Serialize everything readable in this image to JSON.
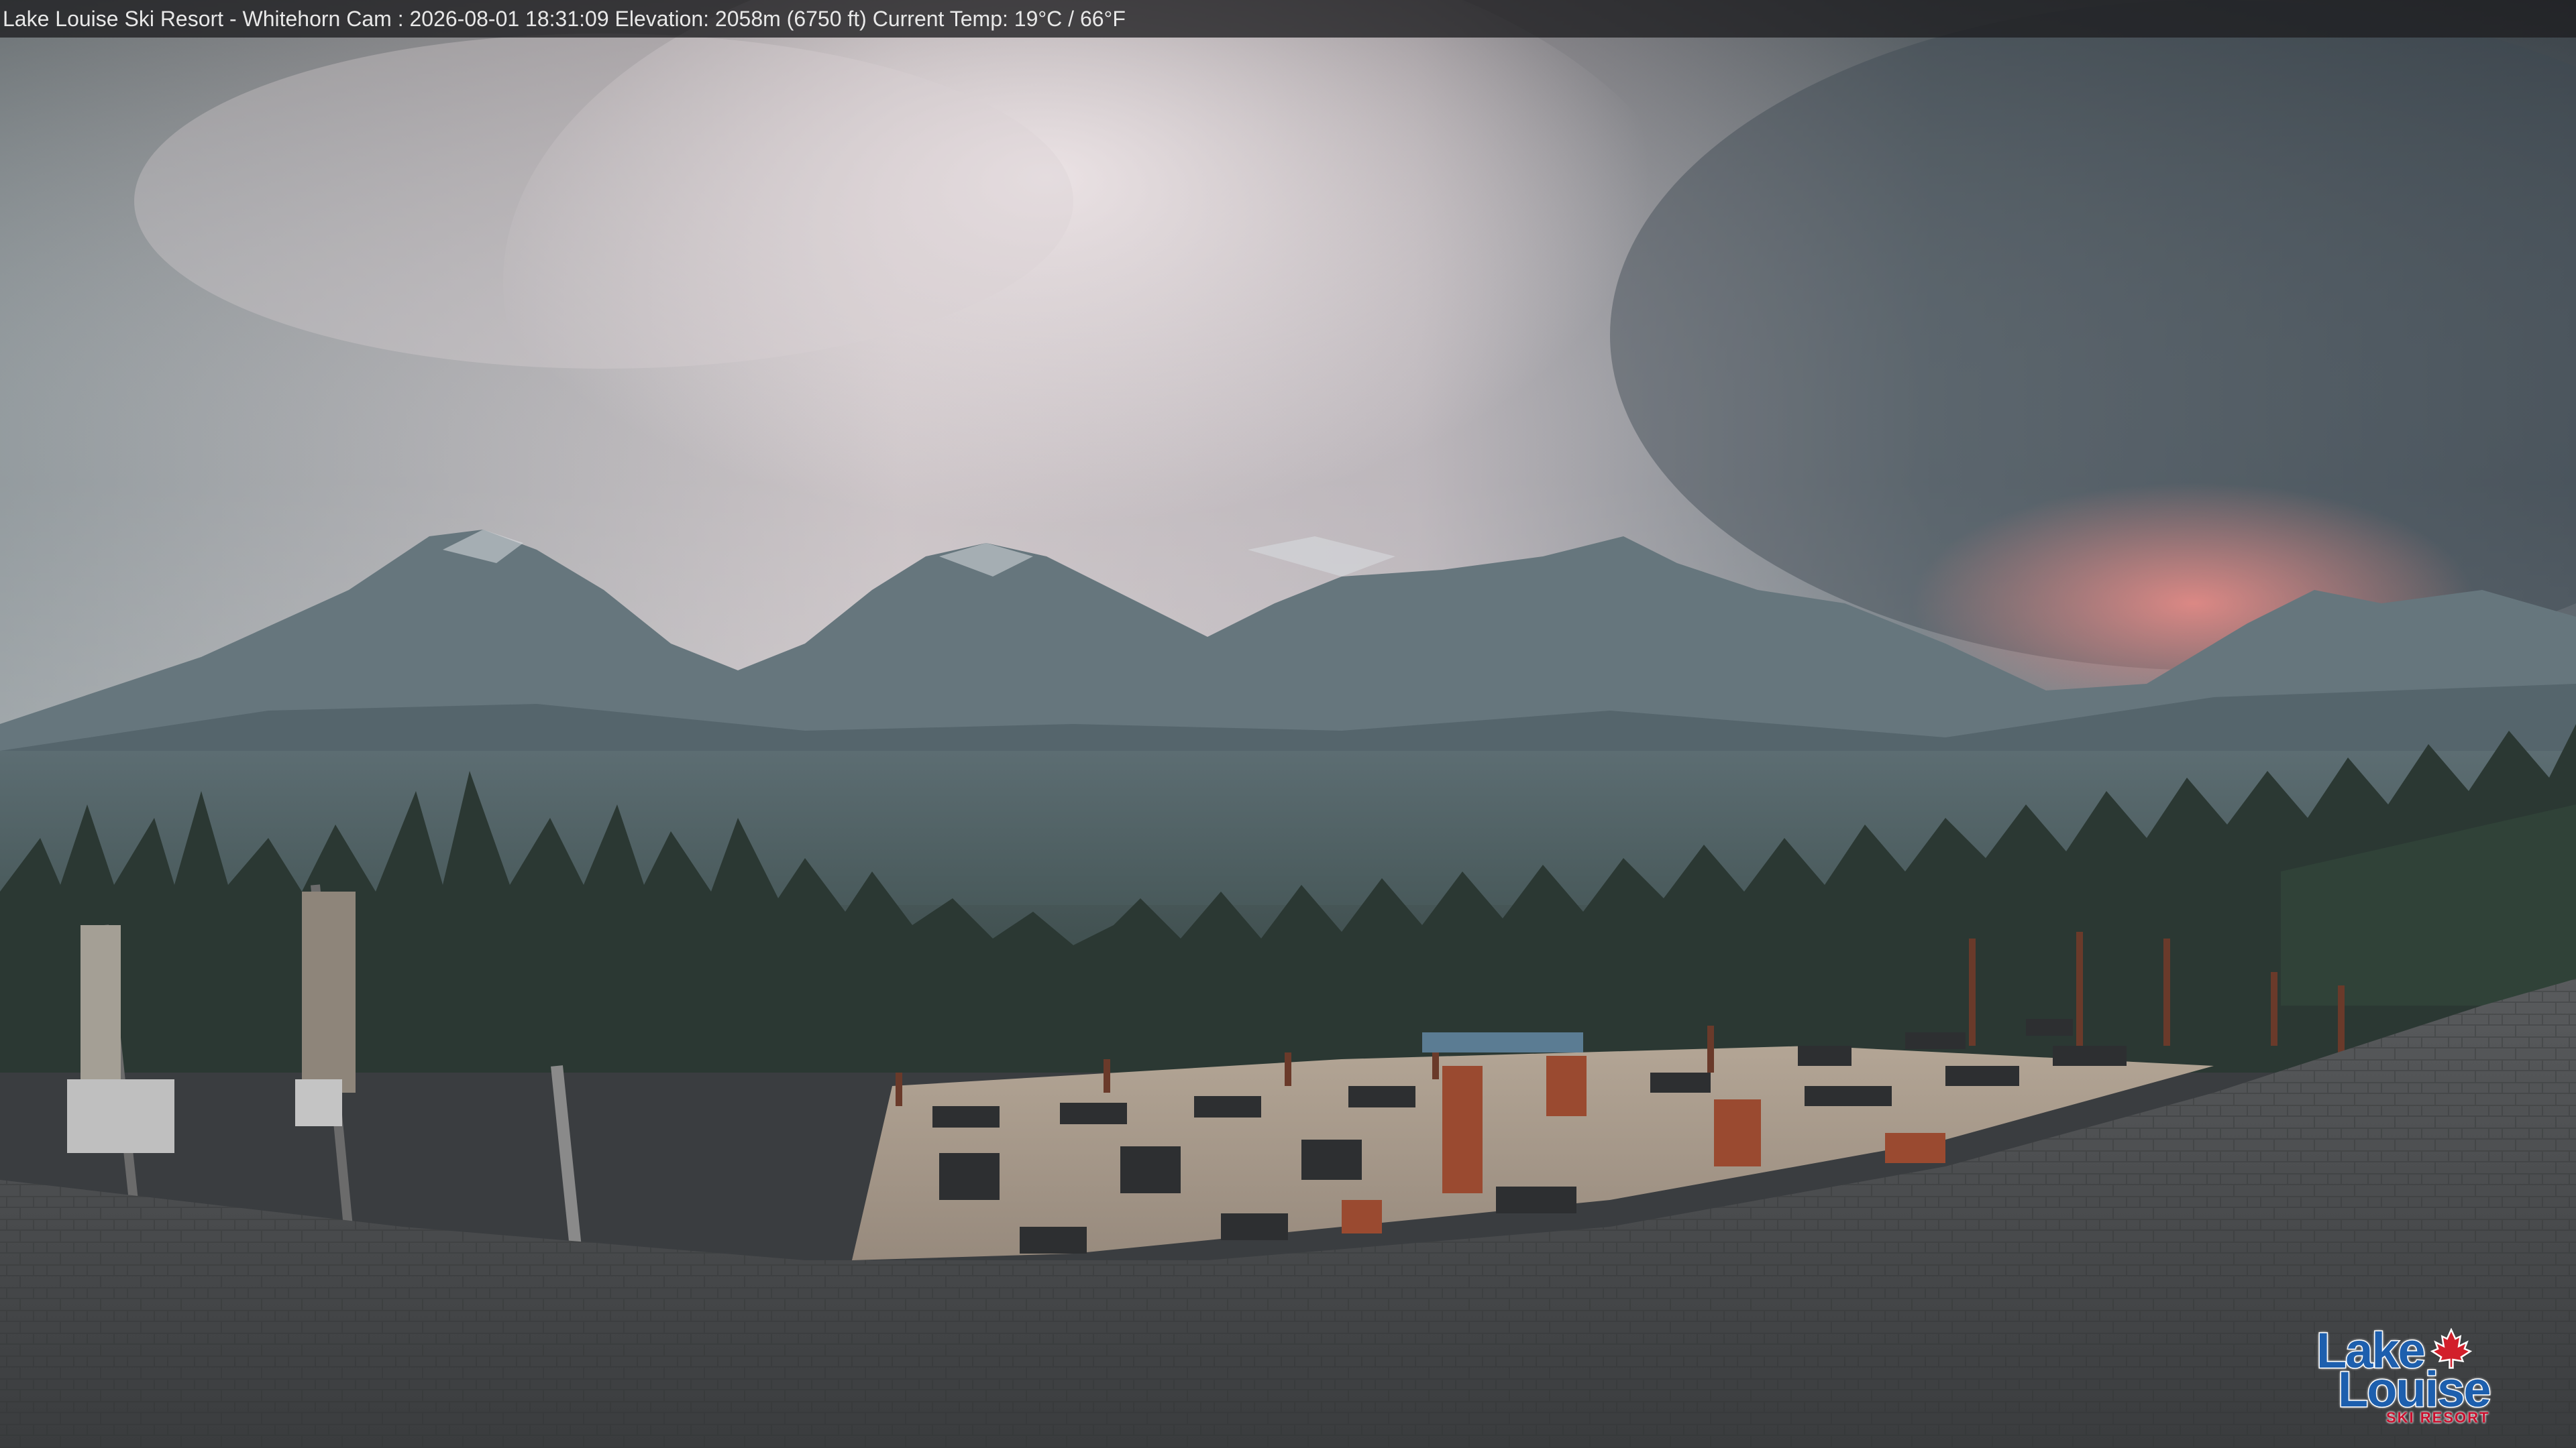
{
  "overlay": {
    "caption": "Lake Louise Ski Resort - Whitehorn Cam : 2026-08-01 18:31:09  Elevation: 2058m (6750 ft) Current Temp: 19°C / 66°F"
  },
  "logo": {
    "line1": "Lake",
    "line2": "Louise",
    "line3": "SKI RESORT",
    "leaf_icon": "maple-leaf-icon",
    "colors": {
      "word": "#1d5fae",
      "leaf": "#d21f2b"
    }
  },
  "colors": {
    "sky_light": "#d6ccd0",
    "sky_dark": "#4f5a63",
    "sunset_glow": "#d88585",
    "mountain": "#5e6d75",
    "forest": "#2c3a34",
    "deck": "#a89a8c",
    "roof": "#454749"
  }
}
